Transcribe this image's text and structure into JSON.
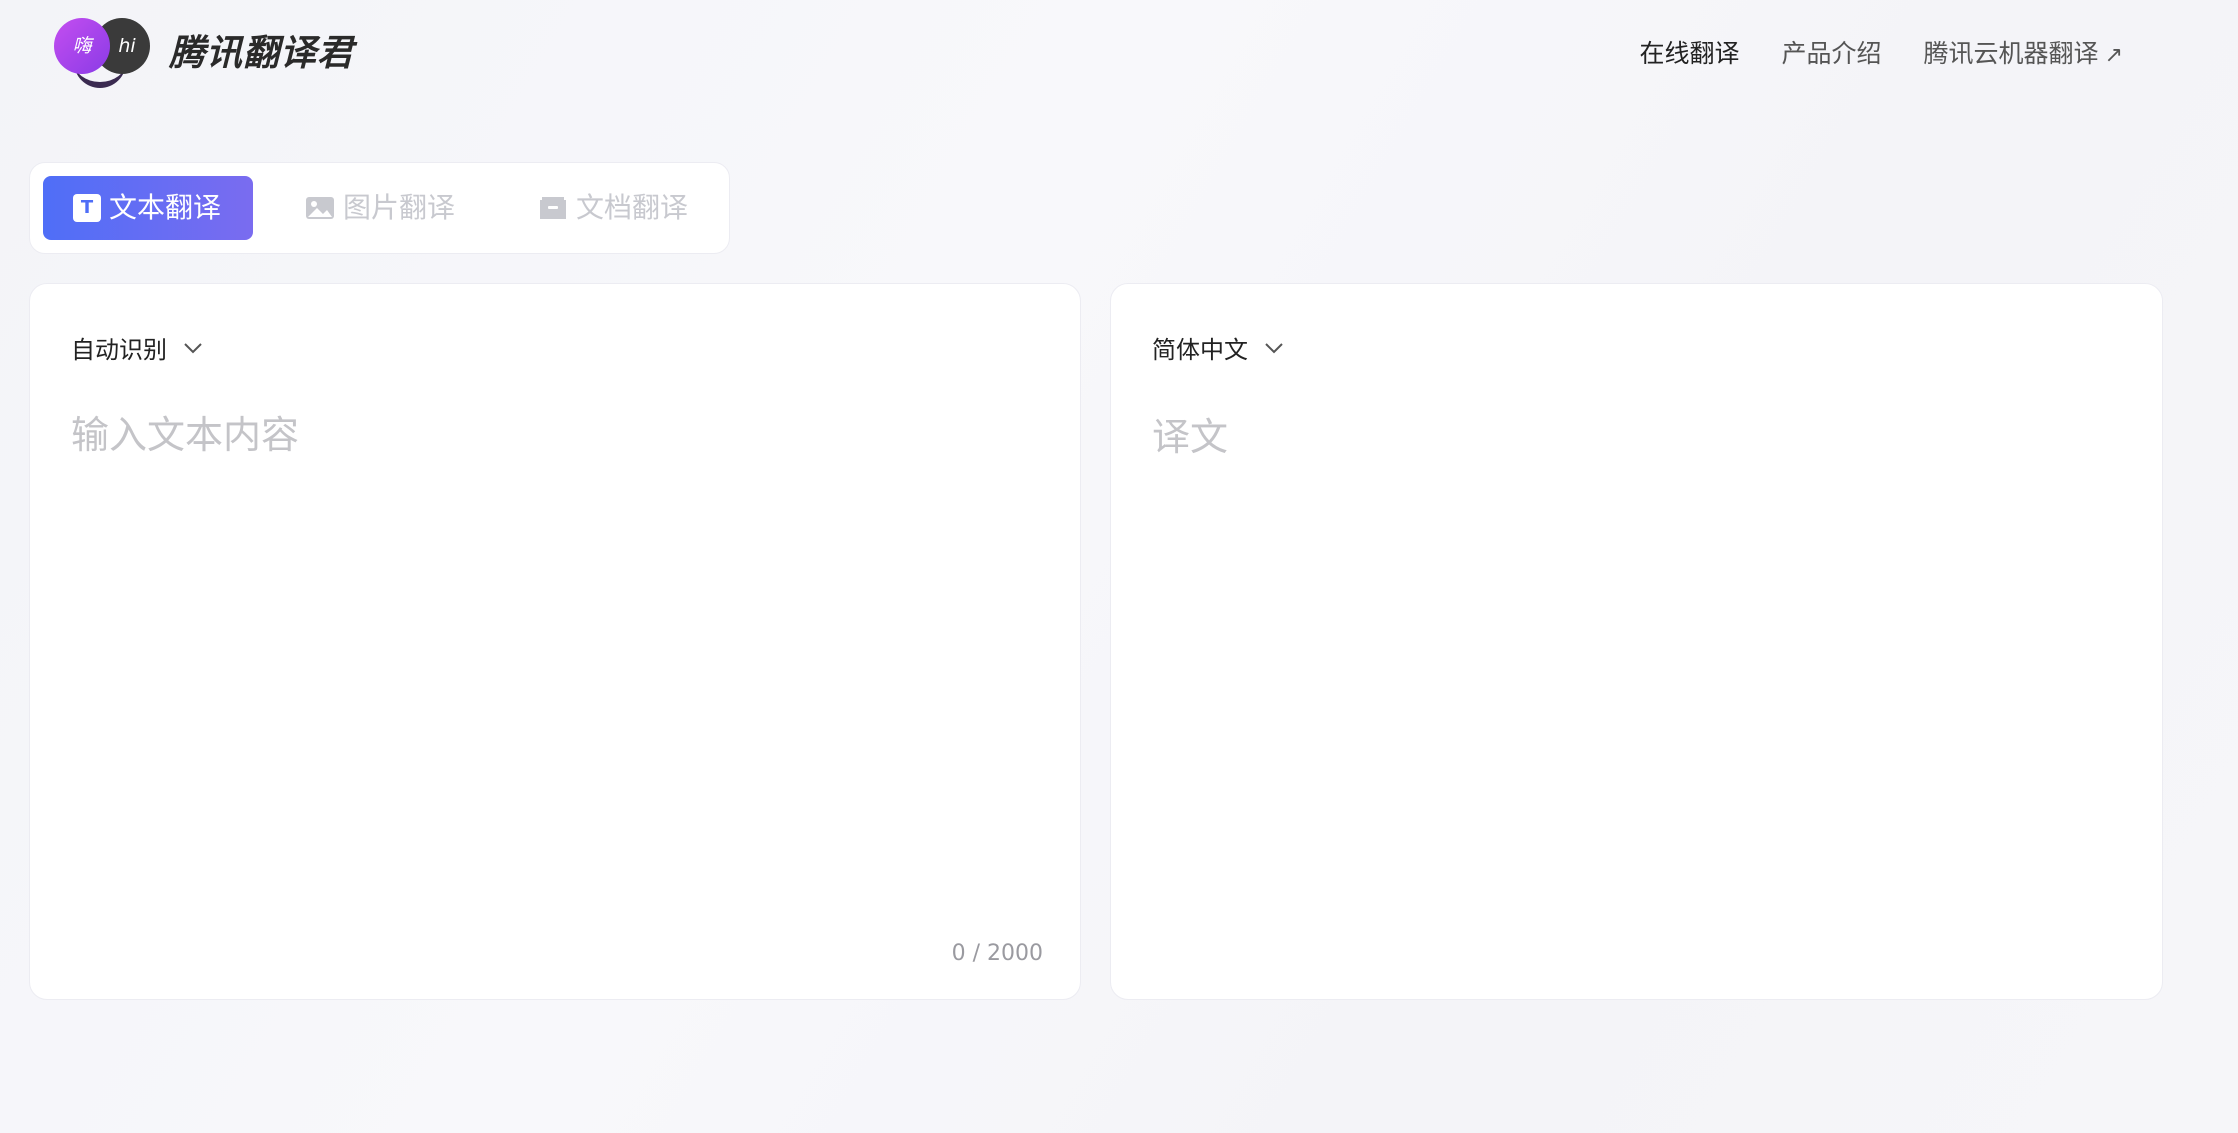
{
  "brand": {
    "logo_left_char": "嗨",
    "logo_right_char": "hi",
    "name": "腾讯翻译君",
    "purple": "#a442ec",
    "dark": "#3a3a3a"
  },
  "nav": {
    "items": [
      {
        "label": "在线翻译",
        "active": true
      },
      {
        "label": "产品介绍",
        "active": false
      },
      {
        "label": "腾讯云机器翻译",
        "active": false,
        "external_icon": "external-link-icon"
      }
    ]
  },
  "tabs": [
    {
      "label": "文本翻译",
      "icon": "text-t-icon",
      "active": true
    },
    {
      "label": "图片翻译",
      "icon": "image-icon",
      "active": false
    },
    {
      "label": "文档翻译",
      "icon": "document-icon",
      "active": false
    }
  ],
  "source": {
    "language": "自动识别",
    "placeholder": "输入文本内容",
    "value": "",
    "char_count": "0 / 2000"
  },
  "target": {
    "language": "简体中文",
    "placeholder": "译文"
  },
  "colors": {
    "accent_start": "#4f6ef7",
    "accent_end": "#7a6cf0",
    "placeholder": "#c4c4c8"
  }
}
